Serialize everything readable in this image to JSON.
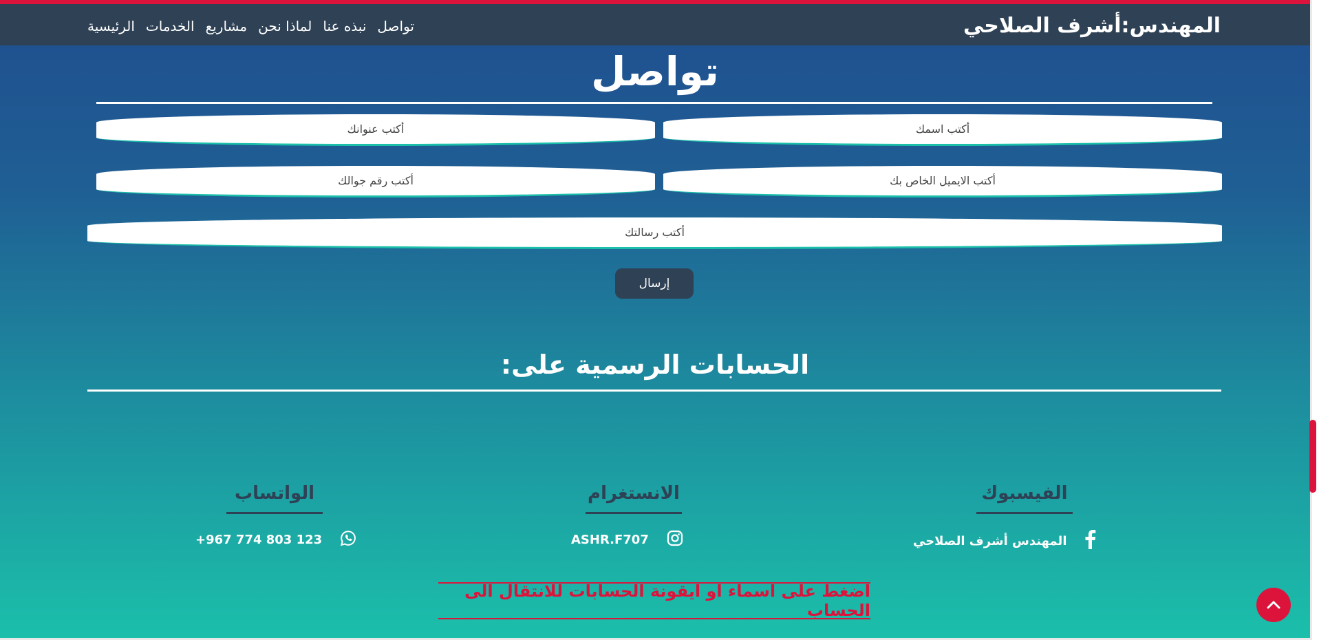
{
  "header": {
    "brand": "المهندس:أشرف الصلاحي",
    "nav": [
      "الرئيسية",
      "الخدمات",
      "مشاريع",
      "لماذا نحن",
      "نبذه عنا",
      "تواصل"
    ]
  },
  "contact": {
    "title": "تواصل",
    "placeholders": {
      "name": "أكتب اسمك",
      "address": "أكتب عنوانك",
      "email": "أكتب الايميل الخاص بك",
      "phone": "أكتب رقم جوالك",
      "message": "أكتب رسالتك"
    },
    "submit_label": "إرسال"
  },
  "accounts": {
    "title": "الحسابات الرسمية على:",
    "facebook": {
      "title": "الفيسبوك",
      "value": "المهندس أشرف الصلاحي",
      "icon": "facebook-icon"
    },
    "instagram": {
      "title": "الانستغرام",
      "value": "ASHR.F707",
      "icon": "instagram-icon"
    },
    "whatsapp": {
      "title": "الواتساب",
      "value": "+967 774 803 123",
      "icon": "whatsapp-icon"
    },
    "hint": "اضغط على اسماء او ايقونة الحسابات للانتقال الى الحساب"
  },
  "colors": {
    "accent": "#dc143c",
    "navbar": "#2e4155",
    "gradient_top": "#1f4e8e",
    "gradient_bottom": "#1bbfaa"
  }
}
